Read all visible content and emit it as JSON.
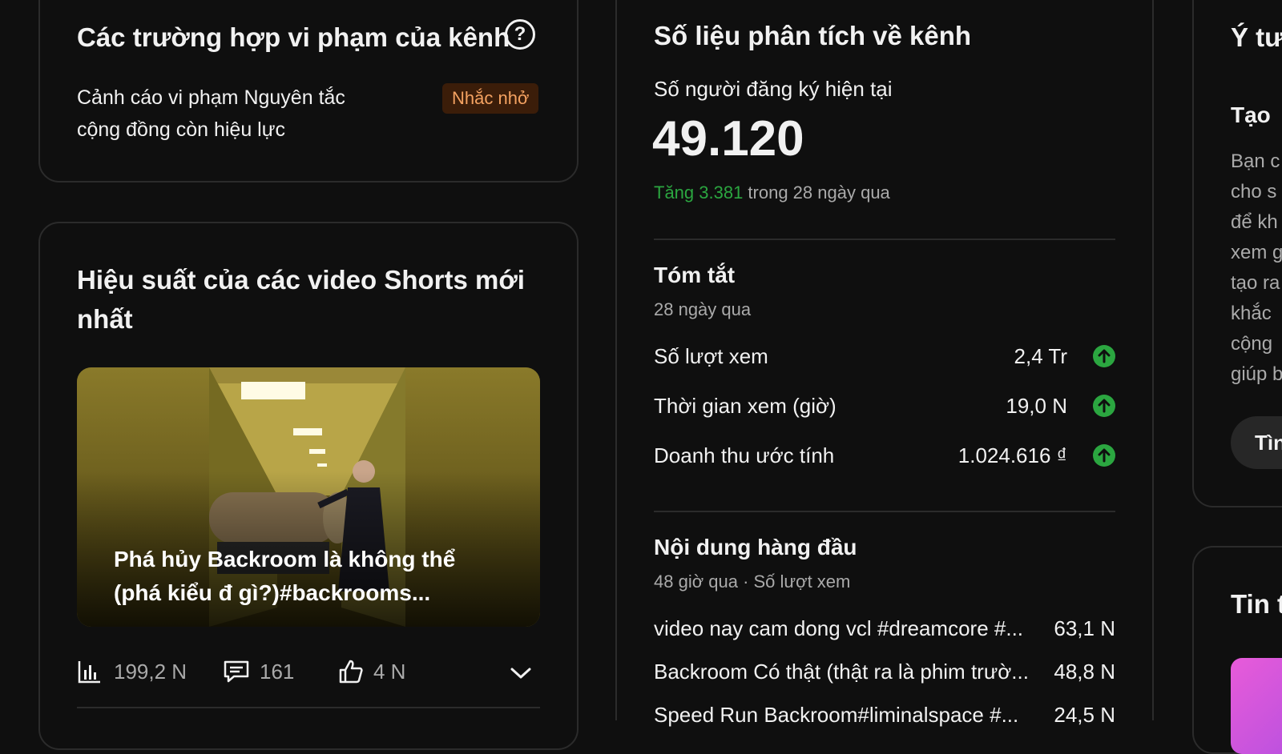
{
  "violations": {
    "title": "Các trường hợp vi phạm của kênh",
    "text_line1": "Cảnh cáo vi phạm Nguyên tắc",
    "text_line2": "cộng đồng còn hiệu lực",
    "badge": "Nhắc nhở",
    "colors": {
      "badge_bg": "#3b1d09",
      "badge_text": "#f4a261"
    }
  },
  "shorts": {
    "title_line1": "Hiệu suất của các video Shorts mới",
    "title_line2": "nhất",
    "video": {
      "title_line1": "Phá hủy Backroom là không thể",
      "title_line2": "(phá kiểu đ gì?)#backrooms..."
    },
    "stats": {
      "views": "199,2 N",
      "comments": "161",
      "likes": "4 N"
    },
    "icons": [
      "bar-chart-icon",
      "comment-icon",
      "thumbs-up-icon",
      "chevron-down-icon"
    ]
  },
  "analytics": {
    "title": "Số liệu phân tích về kênh",
    "subs_label": "Số người đăng ký hiện tại",
    "subs_value": "49.120",
    "change_highlight": "Tăng 3.381",
    "change_rest": " trong 28 ngày qua",
    "summary": {
      "title": "Tóm tắt",
      "period": "28 ngày qua",
      "rows": [
        {
          "label": "Số lượt xem",
          "value": "2,4 Tr"
        },
        {
          "label": "Thời gian xem (giờ)",
          "value": "19,0 N"
        },
        {
          "label": "Doanh thu ước tính",
          "value": "1.024.616 ₫"
        }
      ]
    },
    "top_content": {
      "title": "Nội dung hàng đầu",
      "subtitle": "48 giờ qua · Số lượt xem",
      "items": [
        {
          "title": "video nay cam dong vcl #dreamcore #...",
          "value": "63,1 N"
        },
        {
          "title": "Backroom Có thật (thật ra là phim trườ...",
          "value": "48,8 N"
        },
        {
          "title": "Speed Run Backroom#liminalspace #...",
          "value": "24,5 N"
        }
      ]
    }
  },
  "ideas": {
    "title": "Ý tư",
    "subtitle": "Tạo",
    "body_lines": [
      "Bạn c",
      "cho s",
      "để kh",
      "xem g",
      "tạo ra",
      "khắc",
      "cộng",
      "giúp b"
    ],
    "button": "Tìn"
  },
  "news": {
    "title": "Tin t"
  },
  "colors": {
    "background": "#0f0f0f",
    "card_border": "#2b2b2b",
    "green": "#2ba640",
    "muted": "#aaaaaa"
  }
}
